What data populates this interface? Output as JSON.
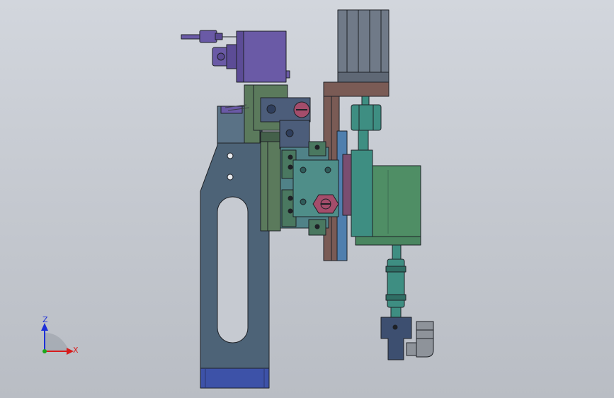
{
  "triad": {
    "z_label": "Z",
    "x_label": "X",
    "colors": {
      "z": "#1d2fd8",
      "x": "#d81d1d",
      "y": "#1aa81a"
    }
  },
  "colors": {
    "background": "#c6cad1",
    "outline": "#1e2126",
    "frame": "#4d6377",
    "frame_base": "#3d52a8",
    "olive": "#5b7a5c",
    "sensor": "#6a5aa6",
    "cylinder": "#707a88",
    "slider": "#508288",
    "slide_rail": "#5f6f86",
    "bracket_brown": "#7a5b55",
    "magenta_nut": "#a44d6b",
    "green_block": "#4f8e65",
    "teal_rod": "#3e8e82",
    "dark_navy": "#3d4f70",
    "fitting": "#8e939a"
  }
}
